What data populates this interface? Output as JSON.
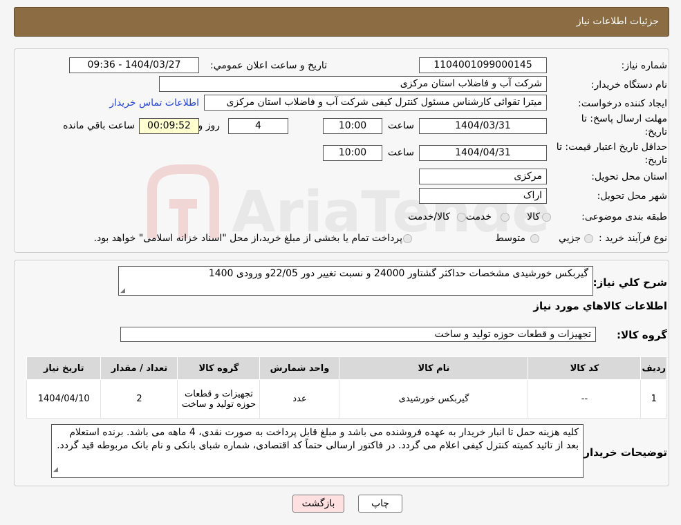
{
  "header": {
    "title": "جزئیات اطلاعات نیاز"
  },
  "fields": {
    "need_number_label": "شماره نیاز:",
    "need_number": "1104001099000145",
    "announce_label": "تاریخ و ساعت اعلان عمومي:",
    "announce_value": "1404/03/27 - 09:36",
    "buyer_org_label": "نام دستگاه خریدار:",
    "buyer_org": "شرکت آب و فاضلاب استان مرکزی",
    "creator_label": "ایجاد کننده درخواست:",
    "creator": "میترا تقوائی کارشناس مسئول کنترل کیفی شرکت آب و فاضلاب استان مرکزی",
    "contact_link": "اطلاعات تماس خریدار",
    "deadline_label_1": "مهلت ارسال پاسخ: تا",
    "deadline_label_2": "تاریخ:",
    "deadline_date": "1404/03/31",
    "time_label": "ساعت",
    "deadline_time": "10:00",
    "days": "4",
    "days_label": "روز و",
    "remaining_time": "00:09:52",
    "remaining_label": "ساعت باقي مانده",
    "validity_label_1": "حداقل تاریخ اعتبار قیمت: تا",
    "validity_label_2": "تاریخ:",
    "validity_date": "1404/04/31",
    "validity_time": "10:00",
    "province_label": "استان محل تحویل:",
    "province": "مرکزی",
    "city_label": "شهر محل تحویل:",
    "city": "اراک",
    "category_label": "طبقه بندی موضوعی:",
    "category_options": [
      "کالا",
      "خدمت",
      "کالا/خدمت"
    ],
    "process_label": "نوع فرآیند خرید :",
    "process_options": [
      "جزیي",
      "متوسط"
    ],
    "process_note": "پرداخت تمام یا بخشی از مبلغ خرید،از محل \"اسناد خزانه اسلامی\" خواهد بود."
  },
  "description": {
    "label": "شرح کلي نیاز:",
    "text": "گیربکس خورشیدی مشخصات حداکثر گشتاور 24000 و نسبت تغییر دور 22/05و ورودی 1400"
  },
  "goods": {
    "section_title": "اطلاعات کالاهاي مورد نیاز",
    "group_label": "گروه کالا:",
    "group_value": "تجهیزات و قطعات حوزه تولید و ساخت",
    "columns": [
      "ردیف",
      "کد کالا",
      "نام کالا",
      "واحد شمارش",
      "گروه کالا",
      "تعداد / مقدار",
      "تاریخ نیاز"
    ],
    "rows": [
      [
        "1",
        "--",
        "گیربکس خورشیدی",
        "عدد",
        "تجهیزات و قطعات حوزه تولید و ساخت",
        "2",
        "1404/04/10"
      ]
    ]
  },
  "buyer_notes": {
    "label": "توضیحات خریدار:",
    "text": "کلیه هزینه حمل تا انبار خریدار به عهده فروشنده می باشد و مبلغ قابل پرداخت به صورت نقدی، 4 ماهه می باشد. برنده استعلام بعد از تائید کمیته کنترل کیفی اعلام می گردد. در فاکتور ارسالی حتماً کد اقتصادی، شماره شبای بانکی و نام بانک مربوطه قید گردد."
  },
  "buttons": {
    "print": "چاپ",
    "back": "بازگشت"
  },
  "watermark": {
    "text": "AriaTender.neT"
  },
  "colors": {
    "header_bg": "#8B6C43",
    "back_button_bg": "#ffe0e0",
    "remaining_bg": "#ffffd0",
    "link": "#2244cc"
  }
}
